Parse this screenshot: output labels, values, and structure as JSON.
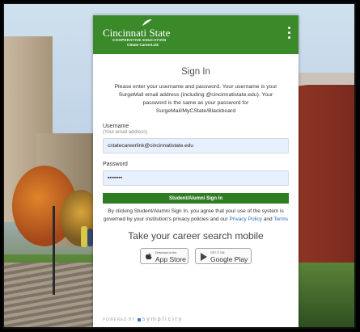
{
  "header": {
    "logo_name": "Cincinnati State",
    "logo_sub": "COOPERATIVE EDUCATION",
    "logo_sub2": "CState CareerLink"
  },
  "signin": {
    "title": "Sign In",
    "description": "Please enter your username and password. Your username is your SurgeMail email address (including @cincinnatistate.edu). Your password is the same as your password for SurgeMail/MyCState/Blackboard",
    "username_label": "Username",
    "username_hint": "(Your email address)",
    "username_value": "cstatecareerlink@cincinnatistate.edu",
    "password_label": "Password",
    "password_value": "••••••••",
    "button_label": "Student/Alumni Sign In",
    "legal_prefix": "By clicking Student/Alumni Sign In, you agree that your use of the system is governed by your institution's privacy policies and our ",
    "privacy_link": "Privacy Policy",
    "legal_and": " and ",
    "terms_link": "Terms"
  },
  "mobile": {
    "title": "Take your career search mobile",
    "app_store_small": "Download on the",
    "app_store_big": "App Store",
    "google_small": "GET IT ON",
    "google_big": "Google Play"
  },
  "footer": {
    "powered_by": "POWERED BY",
    "brand": "symplicity"
  },
  "colors": {
    "header_green": "#3a8a2a",
    "button_green": "#2f7d23",
    "link_blue": "#2d6eb8"
  }
}
